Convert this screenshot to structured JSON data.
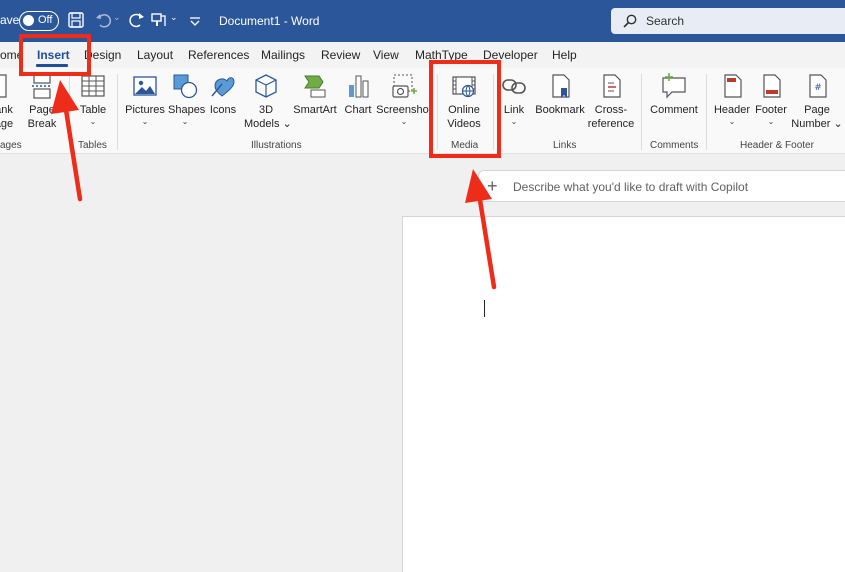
{
  "titlebar": {
    "autosave_label": "ave",
    "toggle_state": "Off",
    "doc_title": "Document1  -  Word",
    "search_placeholder": "Search",
    "icons": [
      "save-icon",
      "undo-icon",
      "redo-icon",
      "format-painter-icon",
      "customize-qat-icon"
    ]
  },
  "tabs": {
    "home": "ome",
    "insert": "Insert",
    "design": "Design",
    "layout": "Layout",
    "references": "References",
    "mailings": "Mailings",
    "review": "Review",
    "view": "View",
    "mathtype": "MathType",
    "developer": "Developer",
    "help": "Help",
    "active": "Insert"
  },
  "ribbon": {
    "blank_page": [
      "ank",
      "age"
    ],
    "page_break": [
      "Page",
      "Break"
    ],
    "table": "Table",
    "pictures": "Pictures",
    "shapes": "Shapes",
    "icons": "Icons",
    "models_3d": [
      "3D",
      "Models"
    ],
    "smartart": "SmartArt",
    "chart": "Chart",
    "screenshot": "Screenshot",
    "online_videos": [
      "Online",
      "Videos"
    ],
    "link": "Link",
    "bookmark": "Bookmark",
    "cross_reference": [
      "Cross-",
      "reference"
    ],
    "comment": "Comment",
    "header": "Header",
    "footer": "Footer",
    "page_number": [
      "Page",
      "Number"
    ],
    "groups": {
      "pages": "ages",
      "tables": "Tables",
      "illustrations": "Illustrations",
      "media": "Media",
      "links": "Links",
      "comments": "Comments",
      "header_footer": "Header & Footer"
    }
  },
  "copilot": {
    "prompt": "Describe what you'd like to draft with Copilot"
  },
  "colors": {
    "titlebar": "#2b579a",
    "annotation": "#ee2c1a",
    "active_tab": "#1f4e9a"
  }
}
